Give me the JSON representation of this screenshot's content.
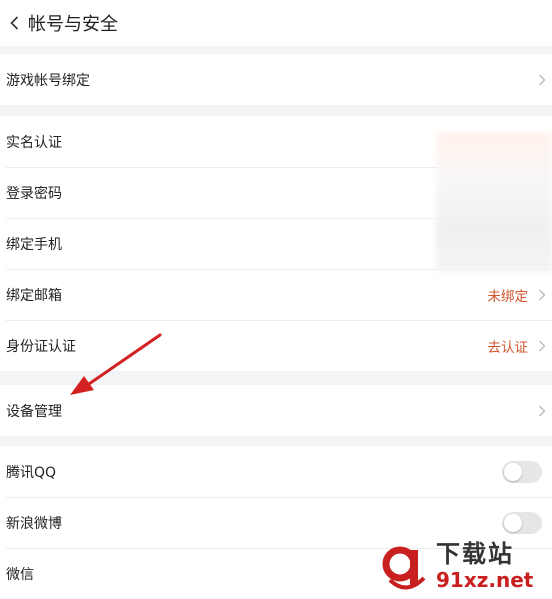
{
  "header": {
    "title": "帐号与安全"
  },
  "sections": {
    "game": [
      {
        "label": "游戏帐号绑定"
      }
    ],
    "account": [
      {
        "label": "实名认证",
        "value": ""
      },
      {
        "label": "登录密码",
        "value": ""
      },
      {
        "label": "绑定手机",
        "value": ""
      },
      {
        "label": "绑定邮箱",
        "value": "未绑定"
      },
      {
        "label": "身份证认证",
        "value": "去认证"
      }
    ],
    "device": [
      {
        "label": "设备管理"
      }
    ],
    "social": [
      {
        "label": "腾讯QQ",
        "enabled": false
      },
      {
        "label": "新浪微博",
        "enabled": false
      },
      {
        "label": "微信"
      }
    ]
  },
  "watermark": {
    "line1": "下载站",
    "line2": "91xz.net"
  },
  "colors": {
    "accent": "#d2542c",
    "arrow": "#d32121",
    "watermark": "#c81f1f"
  }
}
